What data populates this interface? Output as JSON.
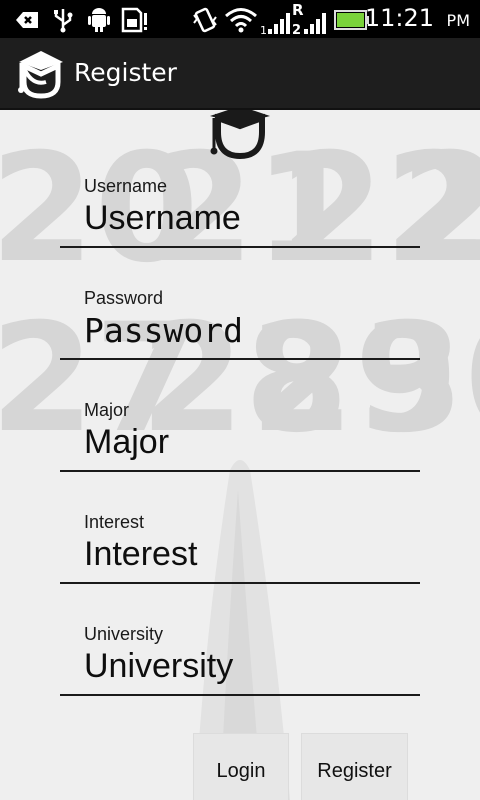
{
  "status_bar": {
    "time": "11:21",
    "ampm": "PM",
    "icons": [
      "back-arrow-icon",
      "usb-icon",
      "android-debug-icon",
      "sd-card-warning-icon",
      "vibrate-icon",
      "wifi-icon",
      "signal-icon",
      "roaming-signal-icon",
      "battery-icon"
    ],
    "roaming_label": "R"
  },
  "action_bar": {
    "title": "Register",
    "logo_icon": "graduation-cap-icon"
  },
  "form": {
    "fields": [
      {
        "label": "Username",
        "placeholder": "Username"
      },
      {
        "label": "Password",
        "placeholder": "Password"
      },
      {
        "label": "Major",
        "placeholder": "Major"
      },
      {
        "label": "Interest",
        "placeholder": "Interest"
      },
      {
        "label": "University",
        "placeholder": "University"
      }
    ]
  },
  "buttons": {
    "login": "Login",
    "register": "Register"
  },
  "colors": {
    "status_bar": "#000000",
    "action_bar": "#1e1e1e",
    "battery": "#7ad23a"
  }
}
